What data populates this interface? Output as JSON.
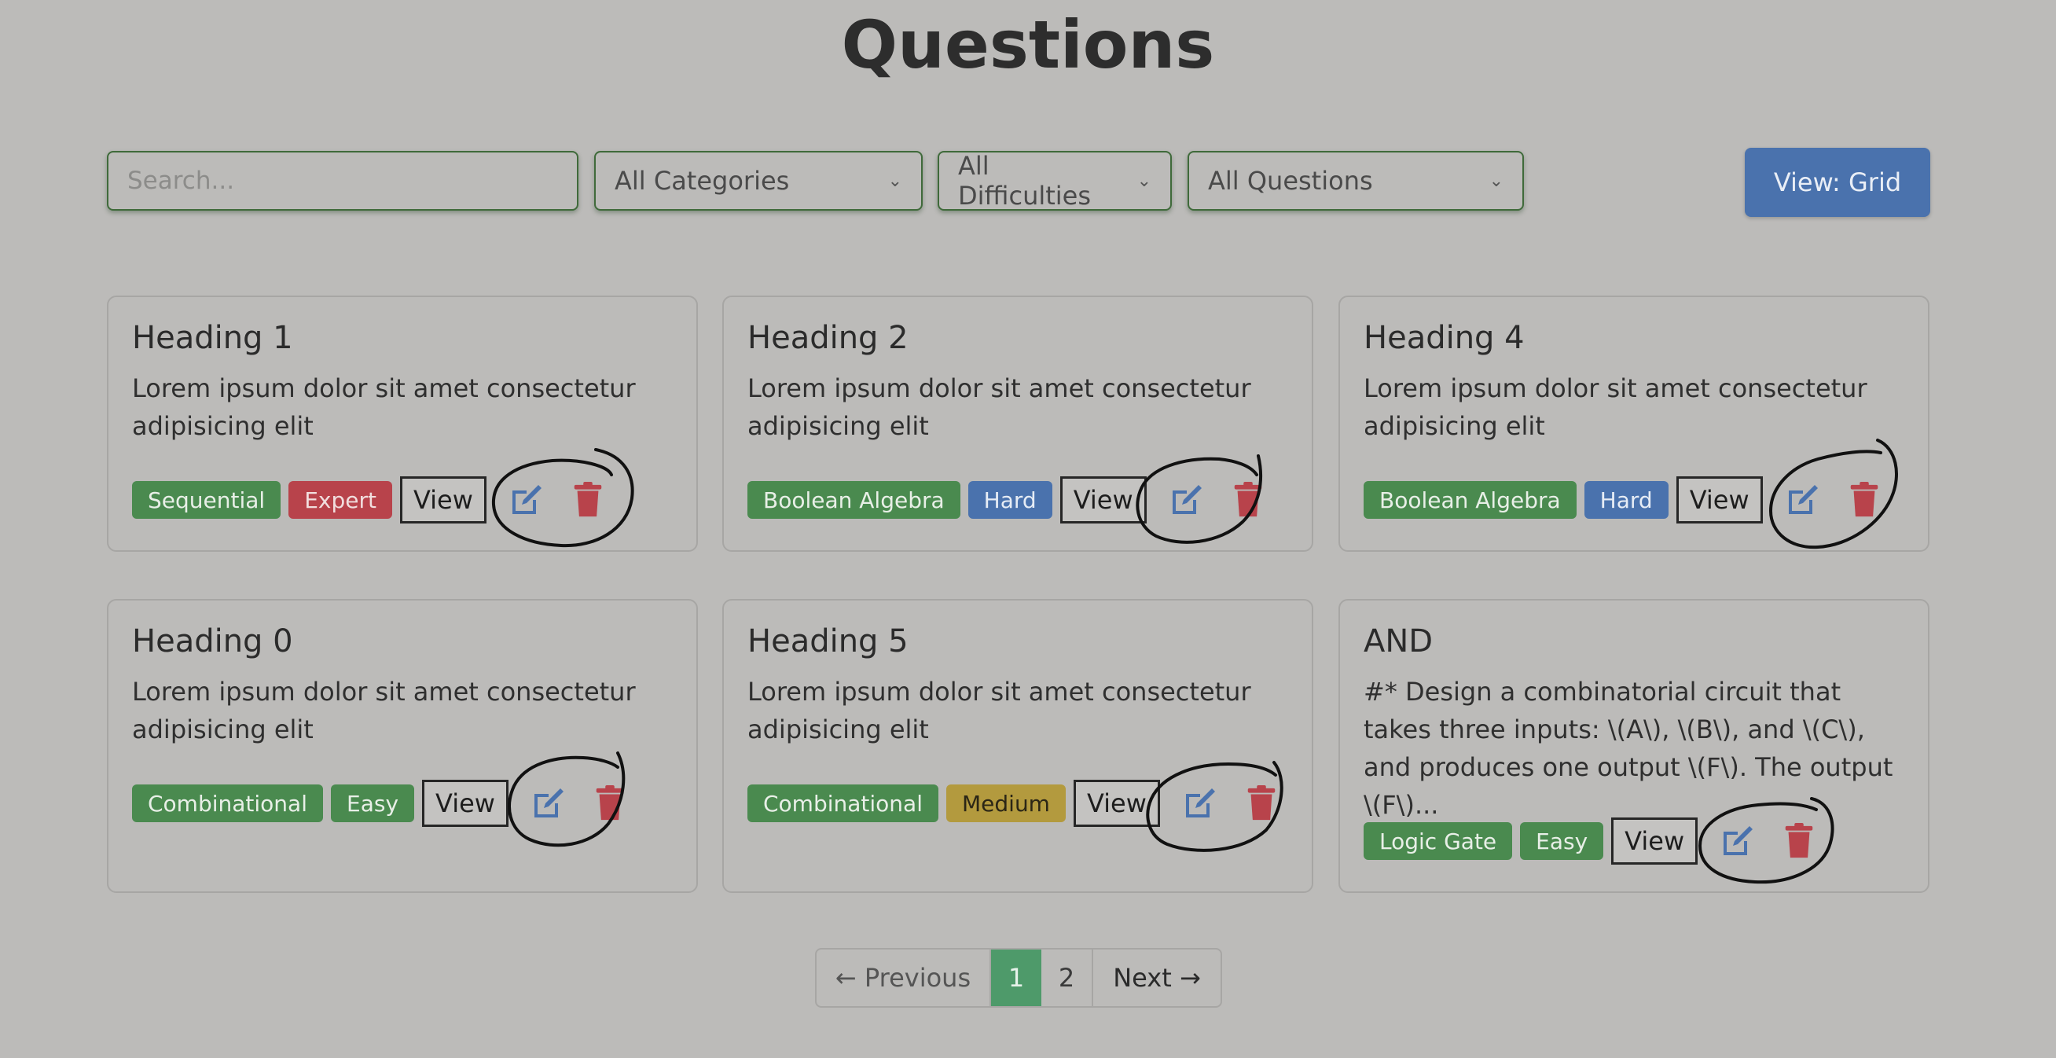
{
  "page": {
    "title": "Questions"
  },
  "filters": {
    "search_placeholder": "Search...",
    "category_selected": "All Categories",
    "difficulty_selected": "All Difficulties",
    "questions_selected": "All Questions",
    "view_toggle_label": "View: Grid"
  },
  "cards": [
    {
      "heading": "Heading 1",
      "body": "Lorem ipsum dolor sit amet consectetur adipisicing elit",
      "tags": [
        {
          "label": "Sequential",
          "color": "#4a8a4f"
        },
        {
          "label": "Expert",
          "color": "#b8434b"
        }
      ],
      "view_label": "View"
    },
    {
      "heading": "Heading 2",
      "body": "Lorem ipsum dolor sit amet consectetur adipisicing elit",
      "tags": [
        {
          "label": "Boolean Algebra",
          "color": "#4a8a4f"
        },
        {
          "label": "Hard",
          "color": "#4a72ad"
        }
      ],
      "view_label": "View"
    },
    {
      "heading": "Heading 4",
      "body": "Lorem ipsum dolor sit amet consectetur adipisicing elit",
      "tags": [
        {
          "label": "Boolean Algebra",
          "color": "#4a8a4f"
        },
        {
          "label": "Hard",
          "color": "#4a72ad"
        }
      ],
      "view_label": "View"
    },
    {
      "heading": "Heading 0",
      "body": "Lorem ipsum dolor sit amet consectetur adipisicing elit",
      "tags": [
        {
          "label": "Combinational",
          "color": "#4a8a4f"
        },
        {
          "label": "Easy",
          "color": "#4a8a4f"
        }
      ],
      "view_label": "View"
    },
    {
      "heading": "Heading 5",
      "body": "Lorem ipsum dolor sit amet consectetur adipisicing elit",
      "tags": [
        {
          "label": "Combinational",
          "color": "#4a8a4f"
        },
        {
          "label": "Medium",
          "color": "#b39a3e"
        }
      ],
      "view_label": "View"
    },
    {
      "heading": "AND",
      "body": "#* Design a combinatorial circuit that takes three inputs: \\(A\\), \\(B\\), and \\(C\\), and produces one output \\(F\\). The output \\(F\\)...",
      "tags": [
        {
          "label": "Logic Gate",
          "color": "#4a8a4f"
        },
        {
          "label": "Easy",
          "color": "#4a8a4f"
        }
      ],
      "view_label": "View"
    }
  ],
  "icons": {
    "edit": "edit-icon",
    "delete": "trash-icon"
  },
  "colors": {
    "edit_icon": "#4a72ad",
    "delete_icon": "#b8434b",
    "active_page": "#4e9a6a",
    "primary_button": "#4a72ad"
  },
  "pagination": {
    "previous_label": "← Previous",
    "pages": [
      "1",
      "2"
    ],
    "current_page": "1",
    "next_label": "Next →"
  }
}
